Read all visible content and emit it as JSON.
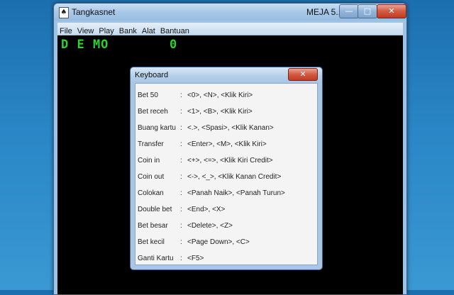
{
  "window": {
    "title": "Tangkasnet",
    "title_right": "MEJA 5...",
    "minimize_symbol": "—",
    "maximize_symbol": "□",
    "close_symbol": "✕",
    "icon": "app-icon"
  },
  "menu": [
    "File",
    "View",
    "Play",
    "Bank",
    "Alat",
    "Bantuan"
  ],
  "game": {
    "mode": "D E MO",
    "credit": "0"
  },
  "dialog": {
    "title": "Keyboard",
    "close_symbol": "✕",
    "separator": ":",
    "shortcuts": [
      {
        "name": "Bet 50",
        "keys": "<0>, <N>, <Klik Kiri>"
      },
      {
        "name": "Bet receh",
        "keys": "<1>, <B>, <Klik Kiri>"
      },
      {
        "name": "Buang kartu",
        "keys": "<.>, <Spasi>, <Klik Kanan>"
      },
      {
        "name": "Transfer",
        "keys": "<Enter>, <M>, <Klik Kiri>"
      },
      {
        "name": "Coin in",
        "keys": "<+>, <=>, <Klik Kiri Credit>"
      },
      {
        "name": "Coin out",
        "keys": "<->, <_>, <Klik Kanan Credit>"
      },
      {
        "name": "Colokan",
        "keys": "<Panah Naik>, <Panah Turun>"
      },
      {
        "name": "Double bet",
        "keys": "<End>, <X>"
      },
      {
        "name": "Bet besar",
        "keys": "<Delete>, <Z>"
      },
      {
        "name": "Bet kecil",
        "keys": "<Page Down>, <C>"
      },
      {
        "name": "Ganti Kartu",
        "keys": "<F5>"
      }
    ]
  }
}
